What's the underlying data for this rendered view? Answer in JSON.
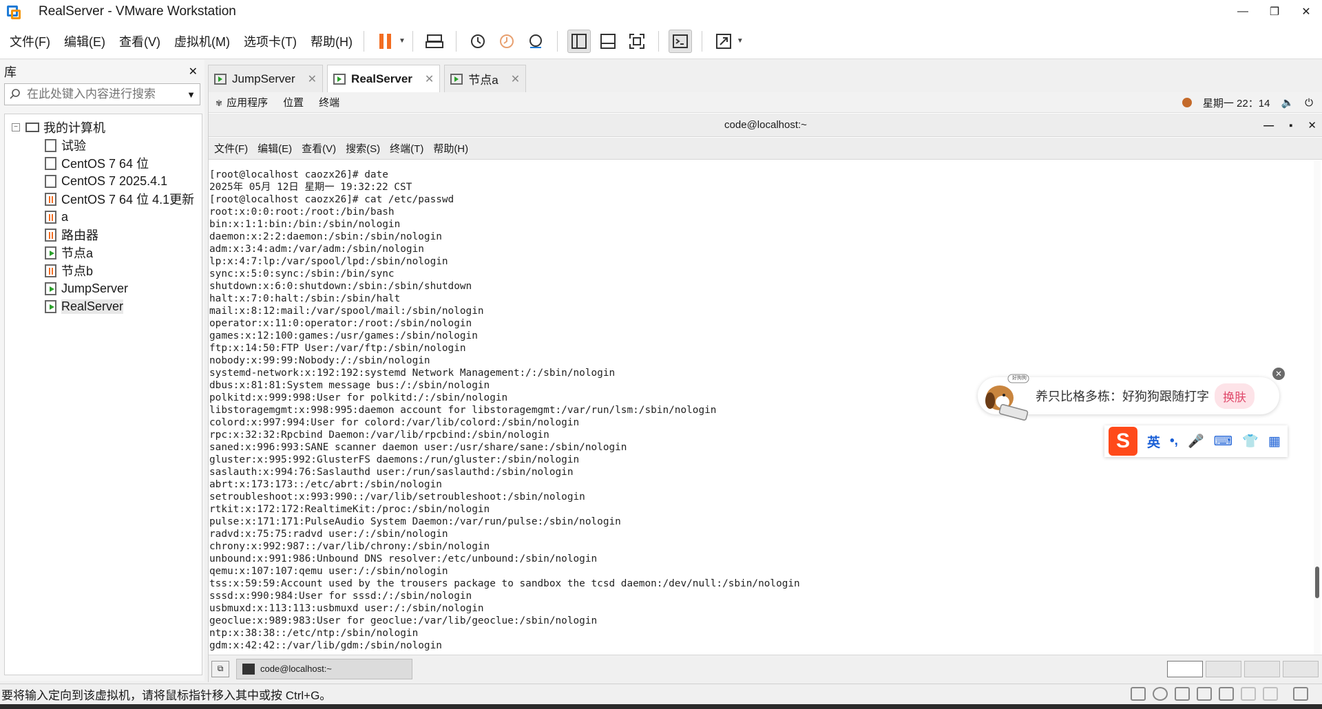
{
  "window": {
    "title": "RealServer - VMware Workstation",
    "minimize": "—",
    "maximize": "❐",
    "close": "✕"
  },
  "menu": [
    "文件(F)",
    "编辑(E)",
    "查看(V)",
    "虚拟机(M)",
    "选项卡(T)",
    "帮助(H)"
  ],
  "library": {
    "title": "库",
    "close": "✕",
    "search_placeholder": "在此处键入内容进行搜索",
    "root": "我的计算机",
    "items": [
      {
        "label": "试验",
        "state": "off"
      },
      {
        "label": "CentOS 7 64 位",
        "state": "off"
      },
      {
        "label": "CentOS 7 2025.4.1",
        "state": "off"
      },
      {
        "label": "CentOS 7 64 位 4.1更新",
        "state": "paused"
      },
      {
        "label": "a",
        "state": "paused"
      },
      {
        "label": "路由器",
        "state": "paused"
      },
      {
        "label": "节点a",
        "state": "running"
      },
      {
        "label": "节点b",
        "state": "paused"
      },
      {
        "label": "JumpServer",
        "state": "running"
      },
      {
        "label": "RealServer",
        "state": "running"
      }
    ]
  },
  "tabs": [
    {
      "label": "JumpServer",
      "close": "✕"
    },
    {
      "label": "RealServer",
      "close": "✕"
    },
    {
      "label": "节点a",
      "close": "✕"
    }
  ],
  "guest": {
    "topbar": {
      "apps": "应用程序",
      "places": "位置",
      "terminal": "终端",
      "clock": "星期一 22：14"
    },
    "terminal": {
      "title": "code@localhost:~",
      "controls": [
        "—",
        "▪",
        "✕"
      ],
      "menu": [
        "文件(F)",
        "编辑(E)",
        "查看(V)",
        "搜索(S)",
        "终端(T)",
        "帮助(H)"
      ],
      "lines": [
        "[root@localhost caozx26]# date",
        "2025年 05月 12日 星期一 19:32:22 CST",
        "[root@localhost caozx26]# cat /etc/passwd",
        "root:x:0:0:root:/root:/bin/bash",
        "bin:x:1:1:bin:/bin:/sbin/nologin",
        "daemon:x:2:2:daemon:/sbin:/sbin/nologin",
        "adm:x:3:4:adm:/var/adm:/sbin/nologin",
        "lp:x:4:7:lp:/var/spool/lpd:/sbin/nologin",
        "sync:x:5:0:sync:/sbin:/bin/sync",
        "shutdown:x:6:0:shutdown:/sbin:/sbin/shutdown",
        "halt:x:7:0:halt:/sbin:/sbin/halt",
        "mail:x:8:12:mail:/var/spool/mail:/sbin/nologin",
        "operator:x:11:0:operator:/root:/sbin/nologin",
        "games:x:12:100:games:/usr/games:/sbin/nologin",
        "ftp:x:14:50:FTP User:/var/ftp:/sbin/nologin",
        "nobody:x:99:99:Nobody:/:/sbin/nologin",
        "systemd-network:x:192:192:systemd Network Management:/:/sbin/nologin",
        "dbus:x:81:81:System message bus:/:/sbin/nologin",
        "polkitd:x:999:998:User for polkitd:/:/sbin/nologin",
        "libstoragemgmt:x:998:995:daemon account for libstoragemgmt:/var/run/lsm:/sbin/nologin",
        "colord:x:997:994:User for colord:/var/lib/colord:/sbin/nologin",
        "rpc:x:32:32:Rpcbind Daemon:/var/lib/rpcbind:/sbin/nologin",
        "saned:x:996:993:SANE scanner daemon user:/usr/share/sane:/sbin/nologin",
        "gluster:x:995:992:GlusterFS daemons:/run/gluster:/sbin/nologin",
        "saslauth:x:994:76:Saslauthd user:/run/saslauthd:/sbin/nologin",
        "abrt:x:173:173::/etc/abrt:/sbin/nologin",
        "setroubleshoot:x:993:990::/var/lib/setroubleshoot:/sbin/nologin",
        "rtkit:x:172:172:RealtimeKit:/proc:/sbin/nologin",
        "pulse:x:171:171:PulseAudio System Daemon:/var/run/pulse:/sbin/nologin",
        "radvd:x:75:75:radvd user:/:/sbin/nologin",
        "chrony:x:992:987::/var/lib/chrony:/sbin/nologin",
        "unbound:x:991:986:Unbound DNS resolver:/etc/unbound:/sbin/nologin",
        "qemu:x:107:107:qemu user:/:/sbin/nologin",
        "tss:x:59:59:Account used by the trousers package to sandbox the tcsd daemon:/dev/null:/sbin/nologin",
        "sssd:x:990:984:User for sssd:/:/sbin/nologin",
        "usbmuxd:x:113:113:usbmuxd user:/:/sbin/nologin",
        "geoclue:x:989:983:User for geoclue:/var/lib/geoclue:/sbin/nologin",
        "ntp:x:38:38::/etc/ntp:/sbin/nologin",
        "gdm:x:42:42::/var/lib/gdm:/sbin/nologin"
      ]
    },
    "taskbar": {
      "task": "code@localhost:~"
    }
  },
  "ime": {
    "pet_label": "好狗狗",
    "message": "养只比格多栋：好狗狗跟随打字",
    "skin_button": "换肤",
    "lang": "英",
    "punct": "•,",
    "close": "✕"
  },
  "status": {
    "text": "要将输入定向到该虚拟机，请将鼠标指针移入其中或按 Ctrl+G。"
  },
  "colors": {
    "accent": "#f26d21",
    "running": "#2aa12a",
    "ime_brand": "#ff4a1a"
  }
}
